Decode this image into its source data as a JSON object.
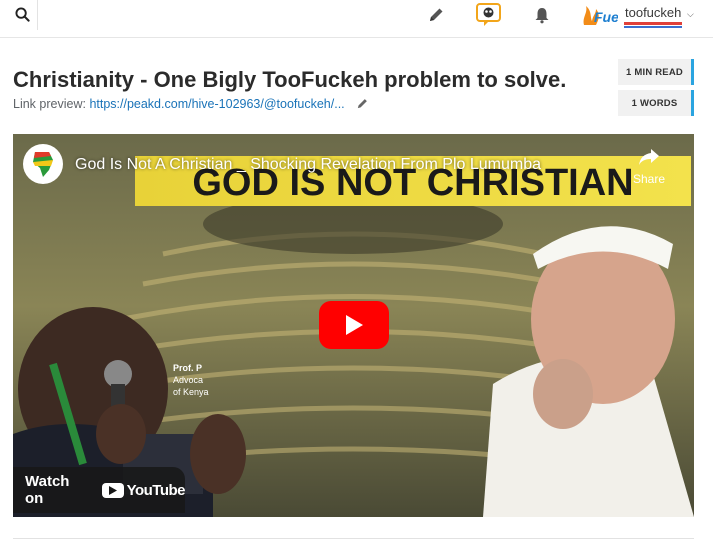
{
  "topbar": {
    "search_icon": "search-icon",
    "edit_icon": "pencil-icon",
    "hivebuzz_icon": "chat-badge-icon",
    "notifications_icon": "bell-icon",
    "logo_text": "Fuel",
    "username": "toofuckeh",
    "accent_red": "#e0403a",
    "accent_blue": "#3a6fd0"
  },
  "post": {
    "title": "Christianity - One Bigly TooFuckeh problem to solve.",
    "link_preview_label": "Link preview:",
    "link_preview_url": "https://peakd.com/hive-102963/@toofuckeh/...",
    "min_read": "1 MIN READ",
    "words": "1 WORDS"
  },
  "video": {
    "title": "God Is Not A Christian _ Shocking Revelation From Plo Lumumba",
    "banner": "GOD IS NOT CHRISTIAN",
    "share_label": "Share",
    "watch_on_label": "Watch on",
    "youtube_label": "YouTube",
    "caption_line1": "Prof. P",
    "caption_line2": "Advoca",
    "caption_line3": "of Kenya",
    "play_color": "#ff0000"
  }
}
